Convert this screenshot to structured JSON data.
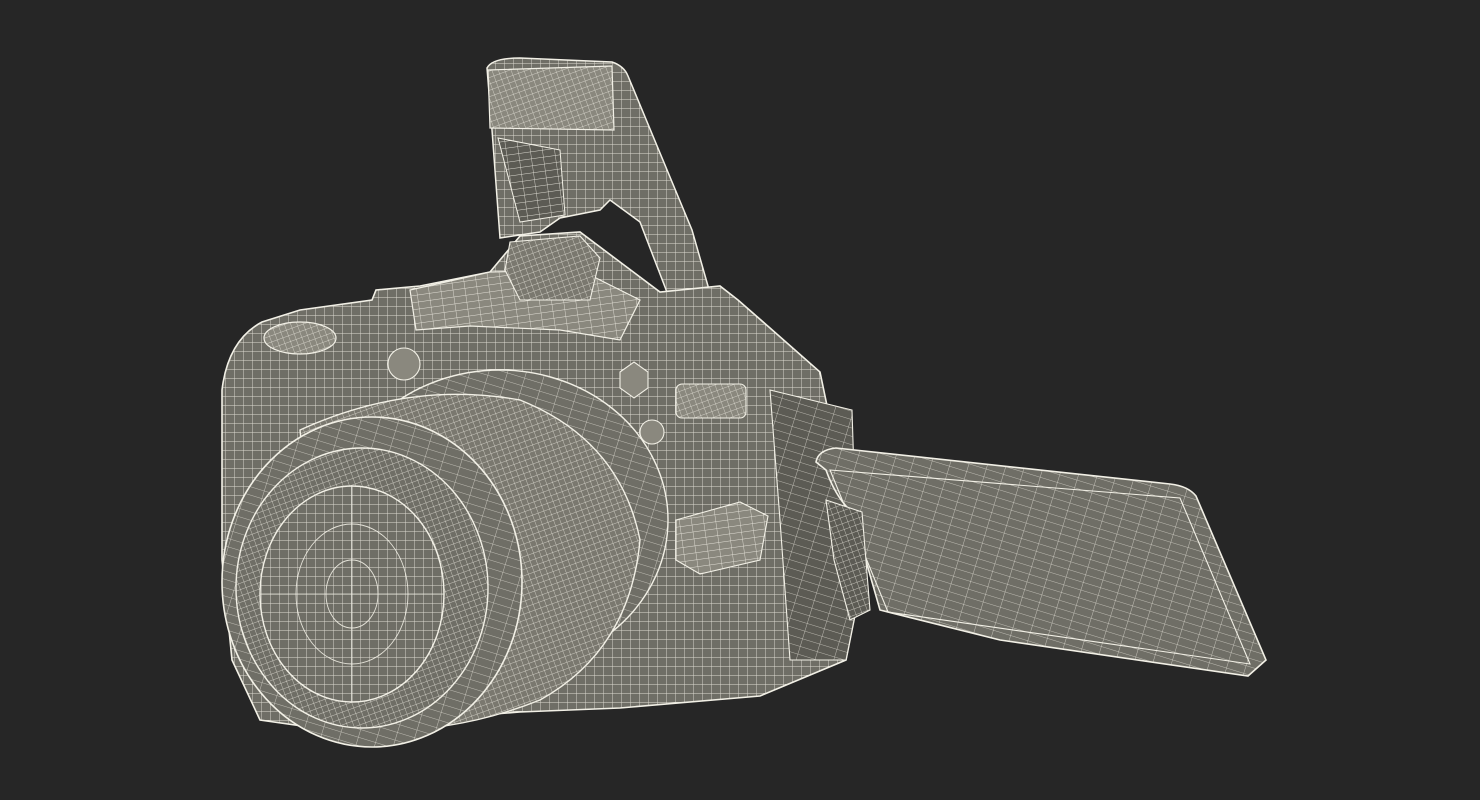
{
  "scene": {
    "subject": "dslr-camera-wireframe-render",
    "colors": {
      "background": "#262626",
      "surface": "#6f6e66",
      "surface_dark": "#5c5b54",
      "surface_light": "#8a887e",
      "wire": "#f2f0e6",
      "wire_dim": "#c9c7bb"
    }
  }
}
